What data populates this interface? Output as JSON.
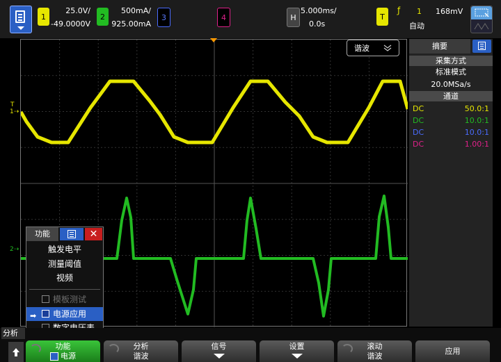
{
  "top": {
    "ch1": {
      "num": "1",
      "scale": "25.0V/",
      "offset": "-49.0000V",
      "color": "#e6e600"
    },
    "ch2": {
      "num": "2",
      "scale": "500mA/",
      "offset": "925.00mA",
      "color": "#22bb22"
    },
    "ch3": {
      "num": "3",
      "color": "#4a6cff"
    },
    "ch4": {
      "num": "4",
      "color": "#e0218a"
    },
    "horizontal": {
      "label": "H",
      "timebase": "5.000ms/",
      "delay": "0.0s"
    },
    "trigger": {
      "label": "T",
      "edge_symbol": "ƒ",
      "source": "1",
      "level": "168mV",
      "mode": "自动"
    }
  },
  "display": {
    "mode_pill_label": "谐波",
    "mode_pill_icon": "chevron-double-down-icon",
    "ch1_marker": "1",
    "ch2_marker": "2",
    "trigger_marker": "T"
  },
  "right_panel": {
    "tab_label": "摘要",
    "acq_section": "采集方式",
    "acq_mode": "标准模式",
    "sample_rate": "20.0MSa/s",
    "channel_section": "通道",
    "channels": [
      {
        "coupling": "DC",
        "probe": "50.0:1",
        "color": "#e6e600"
      },
      {
        "coupling": "DC",
        "probe": "10.0:1",
        "color": "#22bb22"
      },
      {
        "coupling": "DC",
        "probe": "10.0:1",
        "color": "#4a6cff"
      },
      {
        "coupling": "DC",
        "probe": "1.00:1",
        "color": "#e0218a"
      }
    ]
  },
  "popup": {
    "title": "功能",
    "close": "✕",
    "items": [
      "触发电平",
      "测量阈值",
      "视频"
    ],
    "check_items": [
      {
        "label": "模板测试",
        "disabled": true
      },
      {
        "label": "电源应用",
        "selected": true
      },
      {
        "label": "数字电压表",
        "disabled": false
      }
    ]
  },
  "bottom": {
    "analyze_tag": "分析",
    "softkeys": [
      {
        "line1": "功能",
        "line2": "电源"
      },
      {
        "line1": "分析",
        "line2": "谐波"
      },
      {
        "line1": "信号",
        "line2": ""
      },
      {
        "line1": "设置",
        "line2": ""
      },
      {
        "line1": "滚动",
        "line2": "谐波"
      },
      {
        "line1": "应用",
        "line2": ""
      }
    ]
  }
}
